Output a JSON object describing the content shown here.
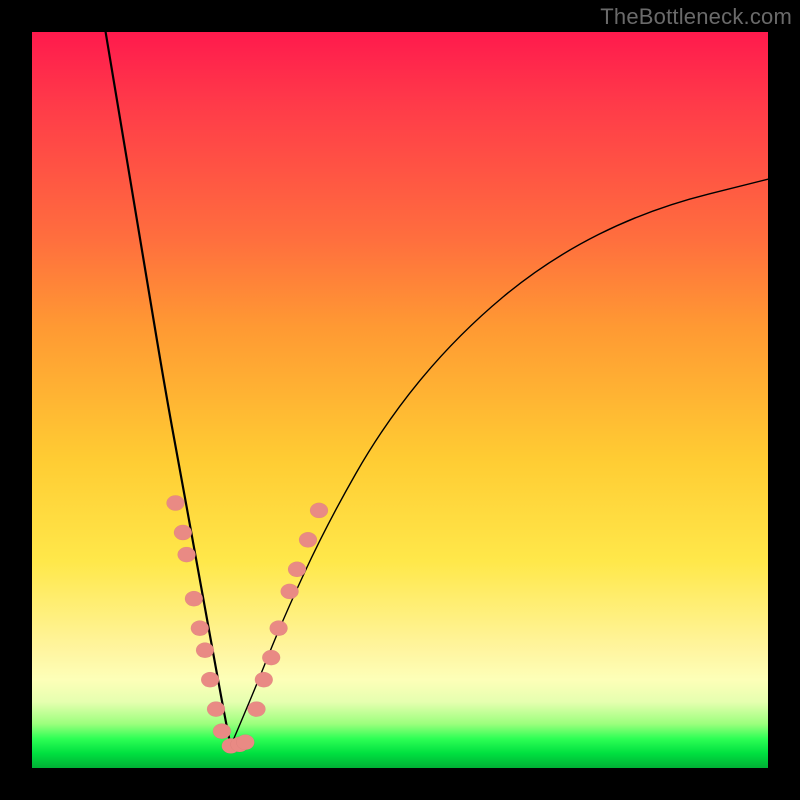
{
  "watermark": "TheBottleneck.com",
  "colors": {
    "frame": "#000000",
    "gradient_top": "#ff1a4d",
    "gradient_mid": "#ffe84a",
    "gradient_green": "#00e040",
    "curve": "#000000",
    "dot": "#e98a84"
  },
  "chart_data": {
    "type": "line",
    "title": "",
    "xlabel": "",
    "ylabel": "",
    "xlim": [
      0,
      100
    ],
    "ylim": [
      0,
      100
    ],
    "note": "V-shaped bottleneck curve with minimum near x≈27; salmon dots cluster along the curve near the bottom (roughly y 3–36).",
    "series": [
      {
        "name": "left-branch",
        "x": [
          10,
          12,
          14,
          16,
          18,
          20,
          22,
          24,
          26,
          27
        ],
        "y": [
          100,
          88,
          76,
          64,
          52,
          41,
          30,
          19,
          8,
          3
        ]
      },
      {
        "name": "right-branch",
        "x": [
          27,
          30,
          34,
          40,
          48,
          58,
          70,
          84,
          100
        ],
        "y": [
          3,
          10,
          20,
          33,
          47,
          59,
          69,
          76,
          80
        ]
      }
    ],
    "dots": [
      {
        "x": 19.5,
        "y": 36
      },
      {
        "x": 20.5,
        "y": 32
      },
      {
        "x": 21.0,
        "y": 29
      },
      {
        "x": 22.0,
        "y": 23
      },
      {
        "x": 22.8,
        "y": 19
      },
      {
        "x": 23.5,
        "y": 16
      },
      {
        "x": 24.2,
        "y": 12
      },
      {
        "x": 25.0,
        "y": 8
      },
      {
        "x": 25.8,
        "y": 5
      },
      {
        "x": 27.0,
        "y": 3
      },
      {
        "x": 28.2,
        "y": 3.2
      },
      {
        "x": 29.0,
        "y": 3.5
      },
      {
        "x": 30.5,
        "y": 8
      },
      {
        "x": 31.5,
        "y": 12
      },
      {
        "x": 32.5,
        "y": 15
      },
      {
        "x": 33.5,
        "y": 19
      },
      {
        "x": 35.0,
        "y": 24
      },
      {
        "x": 36.0,
        "y": 27
      },
      {
        "x": 37.5,
        "y": 31
      },
      {
        "x": 39.0,
        "y": 35
      }
    ]
  }
}
